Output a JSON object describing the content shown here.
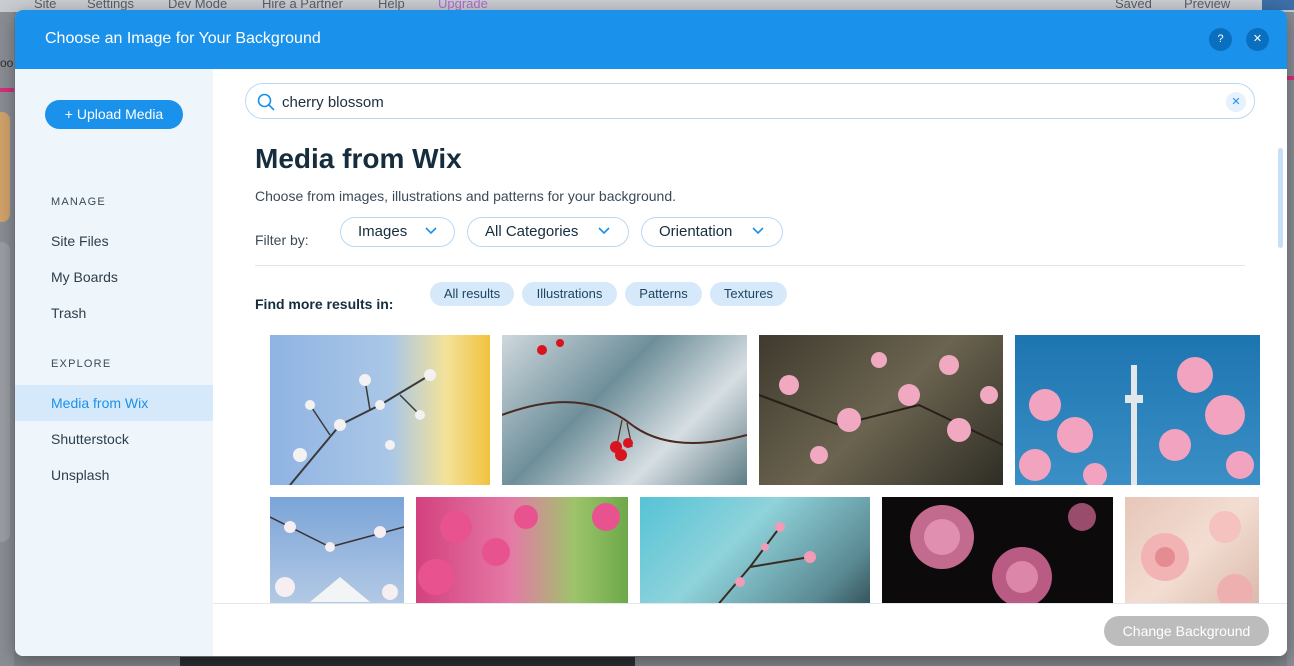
{
  "editor": {
    "menu": [
      "Site",
      "Settings",
      "Dev Mode",
      "Hire a Partner",
      "Help",
      "Upgrade"
    ],
    "right": [
      "Saved",
      "Preview"
    ],
    "left_fragment": "oo"
  },
  "dialog": {
    "title": "Choose an Image for Your Background",
    "help_label": "?",
    "close_label": "✕"
  },
  "sidebar": {
    "upload_label": "+ Upload Media",
    "manage_title": "MANAGE",
    "manage_items": [
      "Site Files",
      "My Boards",
      "Trash"
    ],
    "explore_title": "EXPLORE",
    "explore_items": [
      "Media from Wix",
      "Shutterstock",
      "Unsplash"
    ],
    "active_item": "Media from Wix"
  },
  "search": {
    "value": "cherry blossom",
    "clear_label": "✕"
  },
  "main": {
    "heading": "Media from Wix",
    "subheading": "Choose from images, illustrations and patterns for your background.",
    "filter_label": "Filter by:",
    "filters": [
      "Images",
      "All Categories",
      "Orientation"
    ],
    "more_label": "Find more results in:",
    "chips": [
      "All results",
      "Illustrations",
      "Patterns",
      "Textures"
    ]
  },
  "footer": {
    "change_label": "Change Background"
  },
  "colors": {
    "accent": "#1a91ea",
    "sidebar_bg": "#eef5fb",
    "chip_bg": "#d6e9fb",
    "disabled_button": "#bcbcbc"
  }
}
